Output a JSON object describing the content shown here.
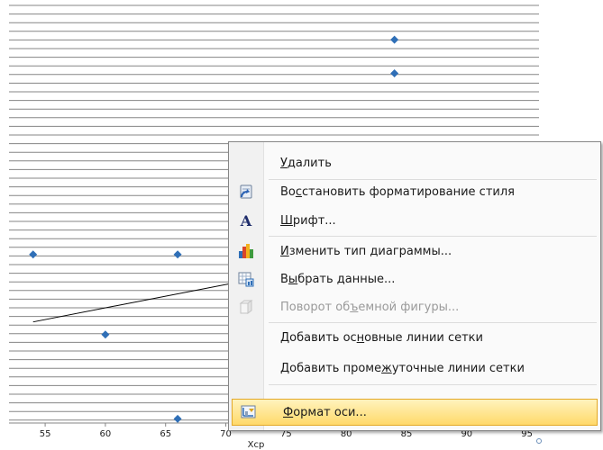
{
  "chart_data": {
    "type": "scatter",
    "x_ticks": [
      "55",
      "60",
      "65",
      "70",
      "75",
      "80",
      "85",
      "90",
      "95"
    ],
    "xlim": [
      52,
      96
    ],
    "ylim": [
      0,
      100
    ],
    "xlabel": "Xcp",
    "series": [
      {
        "points": [
          [
            84,
            91
          ],
          [
            84,
            83
          ],
          [
            54,
            40
          ],
          [
            66,
            40
          ],
          [
            60,
            21
          ],
          [
            66,
            1
          ]
        ]
      }
    ],
    "trendline": {
      "x": [
        54,
        72
      ],
      "y": [
        24,
        34
      ]
    },
    "colors": {
      "points": "#2f6fb7",
      "grid": "#858585",
      "trend": "#000000"
    }
  },
  "context_menu": {
    "items": [
      {
        "pre": "",
        "key": "У",
        "post": "далить",
        "icon": "",
        "disabled": false
      },
      {
        "pre": "Во",
        "key": "с",
        "post": "становить форматирование стиля",
        "icon": "reset-style-icon",
        "disabled": false
      },
      {
        "pre": "",
        "key": "Ш",
        "post": "рифт...",
        "icon": "font-icon",
        "disabled": false
      },
      {
        "pre": "",
        "key": "И",
        "post": "зменить тип диаграммы...",
        "icon": "chart-type-icon",
        "disabled": false
      },
      {
        "pre": "В",
        "key": "ы",
        "post": "брать данные...",
        "icon": "select-data-icon",
        "disabled": false
      },
      {
        "pre": "Поворот об",
        "key": "ъ",
        "post": "емной фигуры...",
        "icon": "3d-rotation-icon",
        "disabled": true
      },
      {
        "pre": "Добавить ос",
        "key": "н",
        "post": "овные линии сетки",
        "icon": "",
        "disabled": false
      },
      {
        "pre": "Добавить проме",
        "key": "ж",
        "post": "уточные линии сетки",
        "icon": "",
        "disabled": false
      },
      {
        "pre": "",
        "key": "Ф",
        "post": "ормат оси...",
        "icon": "format-axis-icon",
        "disabled": false,
        "highlighted": true
      }
    ],
    "font_glyph": "A"
  }
}
